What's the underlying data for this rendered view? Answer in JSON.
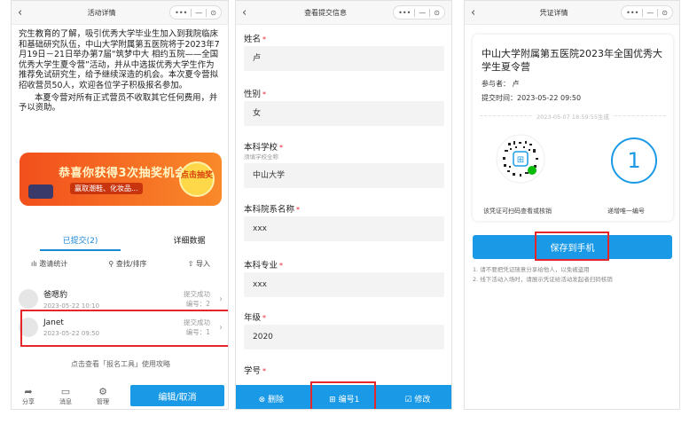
{
  "panel1": {
    "nav_title": "活动详情",
    "intro": "究生教育的了解，吸引优秀大学毕业生加入到我院临床和基础研究队伍，中山大学附属第五医院将于2023年7月19日－21日举办第7届“筑梦中大 相约五院——全国优秀大学生夏令营”活动，并从中选拔优秀大学生作为推荐免试研究生，给予继续深造的机会。本次夏令营拟招收营员50人，欢迎各位学子积极报名参加。",
    "intro2": "本夏令营对所有正式营员不收取其它任何费用，并予以资助。",
    "banner_main": "恭喜你获得3次抽奖机会",
    "banner_sub": "赢取潮鞋、化妆品...",
    "banner_btn": "点击抽奖",
    "tab_submitted": "已提交(2)",
    "tab_detail": "详细数据",
    "tool_invite": "邀请统计",
    "tool_search": "查找/排序",
    "tool_export": "导入",
    "rows": [
      {
        "name": "爸嗯豹",
        "time": "2023-05-22 10:10",
        "status": "提交成功",
        "num": "编号：2"
      },
      {
        "name": "Janet",
        "time": "2023-05-22 09:50",
        "status": "提交成功",
        "num": "编号：1"
      }
    ],
    "guide": "点击查看「报名工具」使用攻略",
    "bottom": {
      "share": "分享",
      "message": "消息",
      "manage": "管理",
      "edit": "编辑/取消"
    }
  },
  "panel2": {
    "nav_title": "查看提交信息",
    "fields": [
      {
        "label": "姓名",
        "value": "卢",
        "hint": ""
      },
      {
        "label": "性别",
        "value": "女",
        "hint": ""
      },
      {
        "label": "本科学校",
        "value": "中山大学",
        "hint": "须填学校全称"
      },
      {
        "label": "本科院系名称",
        "value": "xxx",
        "hint": ""
      },
      {
        "label": "本科专业",
        "value": "xxx",
        "hint": ""
      },
      {
        "label": "年级",
        "value": "2020",
        "hint": ""
      },
      {
        "label": "学号",
        "value": "",
        "hint": ""
      }
    ],
    "actions": {
      "delete": "删除",
      "number": "编号1",
      "modify": "修改"
    }
  },
  "panel3": {
    "nav_title": "凭证详情",
    "title": "中山大学附属第五医院2023年全国优秀大学生夏令营",
    "participant": "参与者： 卢",
    "submit_time": "提交时间：2023-05-22 09:50",
    "generated": "2023-05-07 18:59:55生成",
    "number": "1",
    "qr_caption": "该凭证可扫码查看或核销",
    "num_caption": "递增唯一编号",
    "save": "保存到手机",
    "note1": "1. 请不要把凭证随意分享给他人，以免被盗用",
    "note2": "2. 线下活动入场时，请展示凭证给活动发起者扫码核销"
  },
  "colors": {
    "accent": "#1a9ae6",
    "highlight": "#e5262b",
    "banner": "#f24f1c"
  }
}
